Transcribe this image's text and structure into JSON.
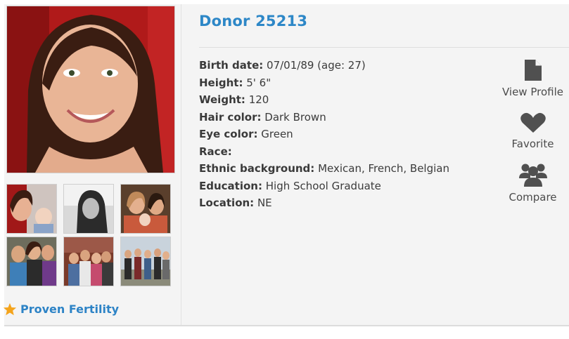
{
  "donor": {
    "title": "Donor 25213",
    "fields": [
      {
        "label": "Birth date:",
        "value": "07/01/89 (age: 27)"
      },
      {
        "label": "Height:",
        "value": "5' 6\""
      },
      {
        "label": "Weight:",
        "value": "120"
      },
      {
        "label": "Hair color:",
        "value": "Dark Brown"
      },
      {
        "label": "Eye color:",
        "value": "Green"
      },
      {
        "label": "Race:",
        "value": ""
      },
      {
        "label": "Ethnic background:",
        "value": "Mexican, French, Belgian"
      },
      {
        "label": "Education:",
        "value": "High School Graduate"
      },
      {
        "label": "Location:",
        "value": "NE"
      }
    ]
  },
  "badge": {
    "label": "Proven Fertility",
    "icon": "star-icon",
    "color": "#2d83c6",
    "star_color": "#f4a41c"
  },
  "actions": [
    {
      "label": "View Profile",
      "icon": "document-icon"
    },
    {
      "label": "Favorite",
      "icon": "heart-icon"
    },
    {
      "label": "Compare",
      "icon": "users-icon"
    }
  ],
  "colors": {
    "accent": "#2d87c7",
    "icon": "#505050",
    "panel": "#f4f4f4"
  }
}
